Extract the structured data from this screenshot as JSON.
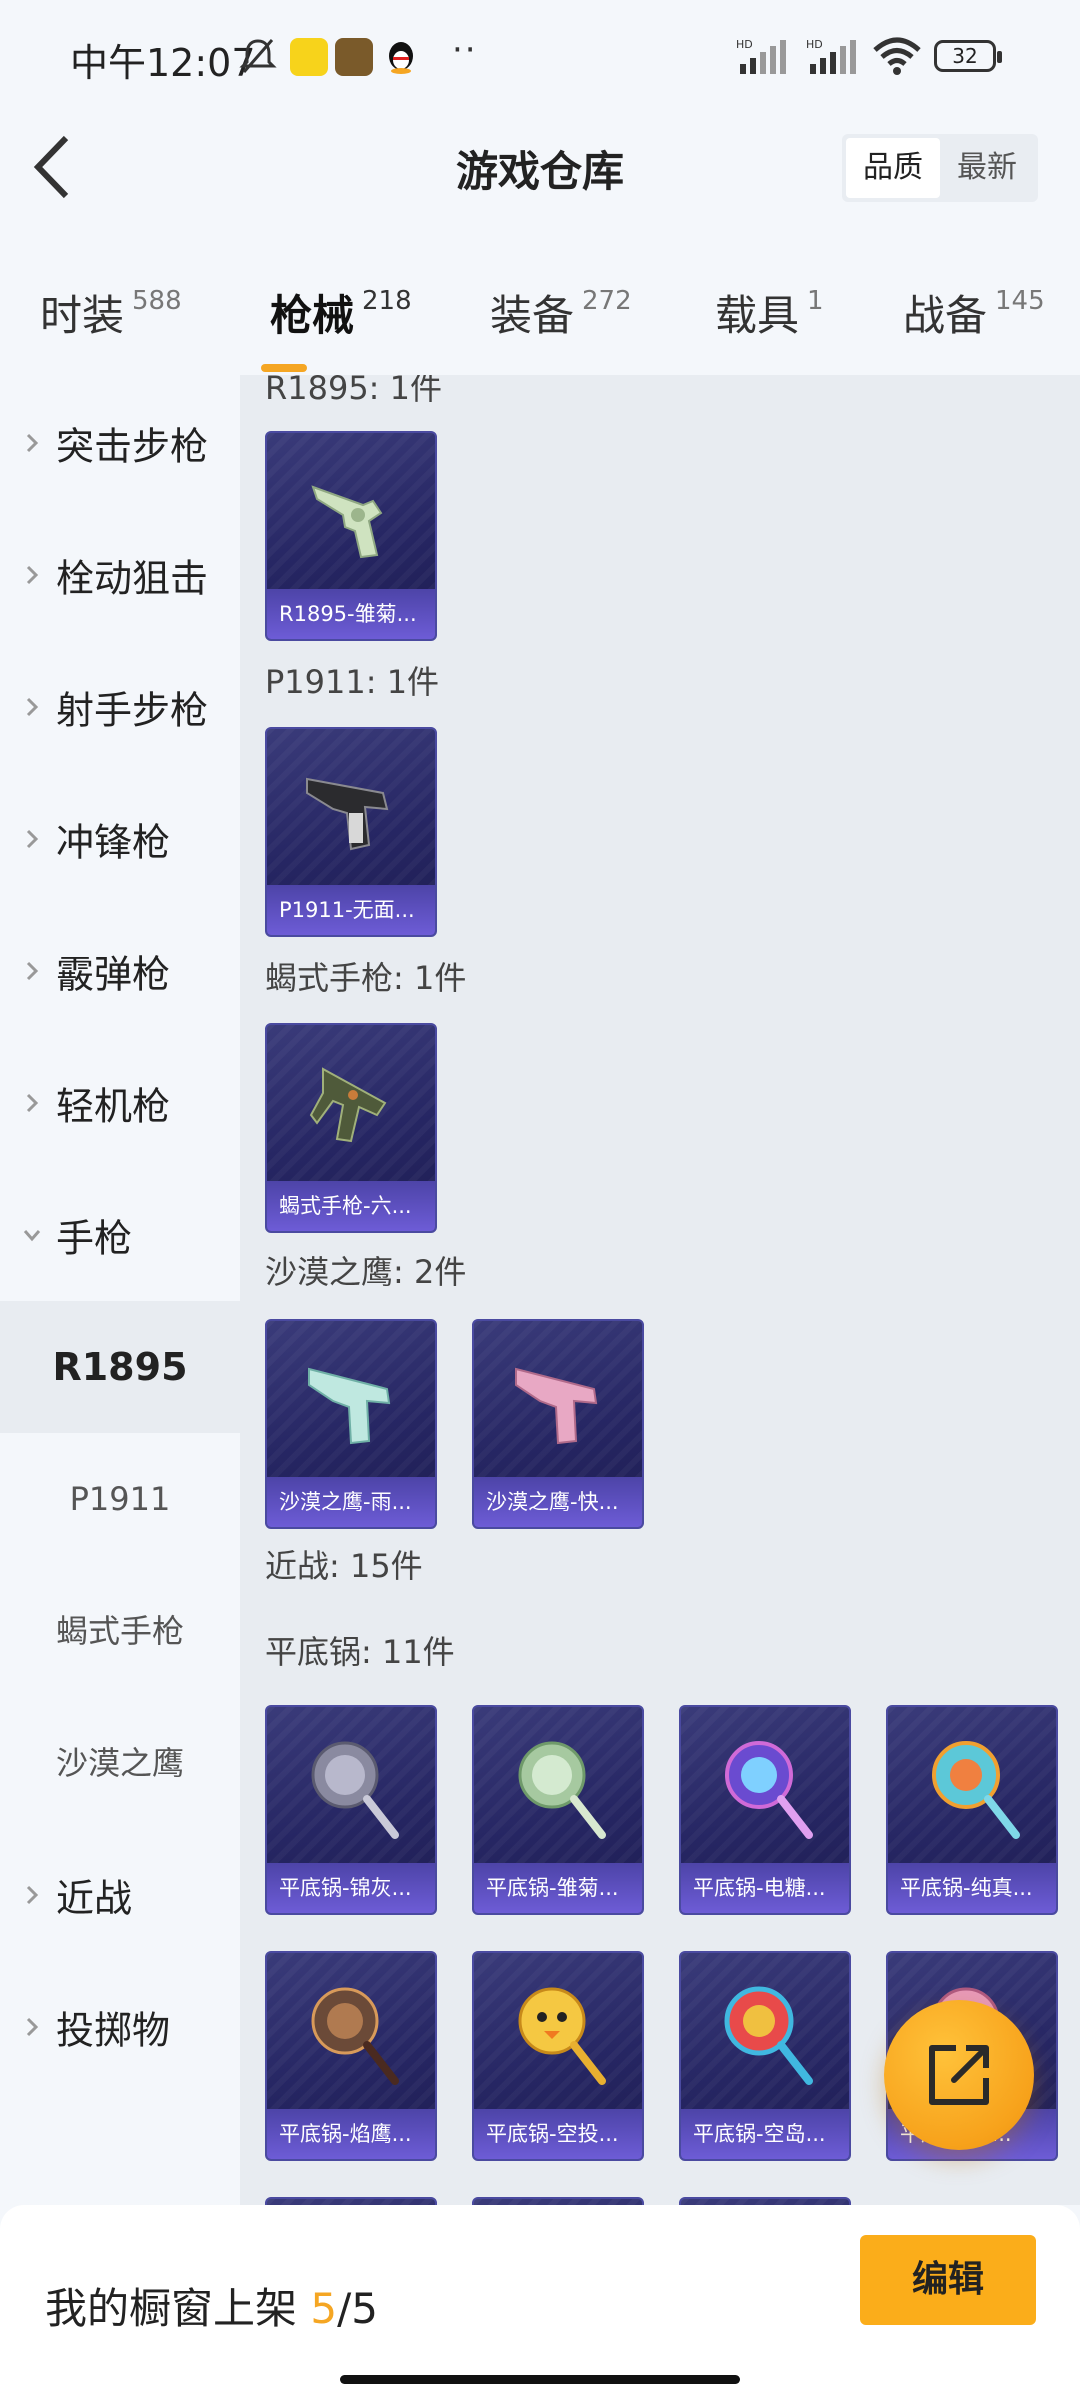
{
  "status": {
    "time": "中午12:07",
    "battery": "32",
    "net1": "HD",
    "net2": "HD"
  },
  "header": {
    "title": "游戏仓库",
    "sort_quality": "品质",
    "sort_latest": "最新"
  },
  "tabs": [
    {
      "label": "时装",
      "count": "588"
    },
    {
      "label": "枪械",
      "count": "218"
    },
    {
      "label": "装备",
      "count": "272"
    },
    {
      "label": "载具",
      "count": "1"
    },
    {
      "label": "战备",
      "count": "145"
    }
  ],
  "sidebar": {
    "categories": [
      "突击步枪",
      "栓动狙击",
      "射手步枪",
      "冲锋枪",
      "霰弹枪",
      "轻机枪",
      "手枪",
      "近战",
      "投掷物"
    ],
    "pistol_subs": [
      "R1895",
      "P1911",
      "蝎式手枪",
      "沙漠之鹰"
    ]
  },
  "groups": {
    "r1895": "R1895: 1件",
    "p1911": "P1911: 1件",
    "scorpion": "蝎式手枪: 1件",
    "deagle": "沙漠之鹰: 2件",
    "melee": "近战: 15件",
    "pan": "平底锅: 11件"
  },
  "items": {
    "r1895": "R1895-雏菊...",
    "p1911": "P1911-无面...",
    "scorpion": "蝎式手枪-六...",
    "deagle1": "沙漠之鹰-雨...",
    "deagle2": "沙漠之鹰-快...",
    "pans": [
      "平底锅-锦灰...",
      "平底锅-雏菊...",
      "平底锅-电糖...",
      "平底锅-纯真...",
      "平底锅-焰鹰...",
      "平底锅-空投...",
      "平底锅-空岛...",
      "平底锅-闪..."
    ]
  },
  "bottom": {
    "label": "我的橱窗上架",
    "used": "5",
    "total": "/5",
    "edit": "编辑"
  },
  "colors": {
    "accent": "#f5a623",
    "card_bg": "#262663",
    "card_caption": "#6d5cd6"
  }
}
